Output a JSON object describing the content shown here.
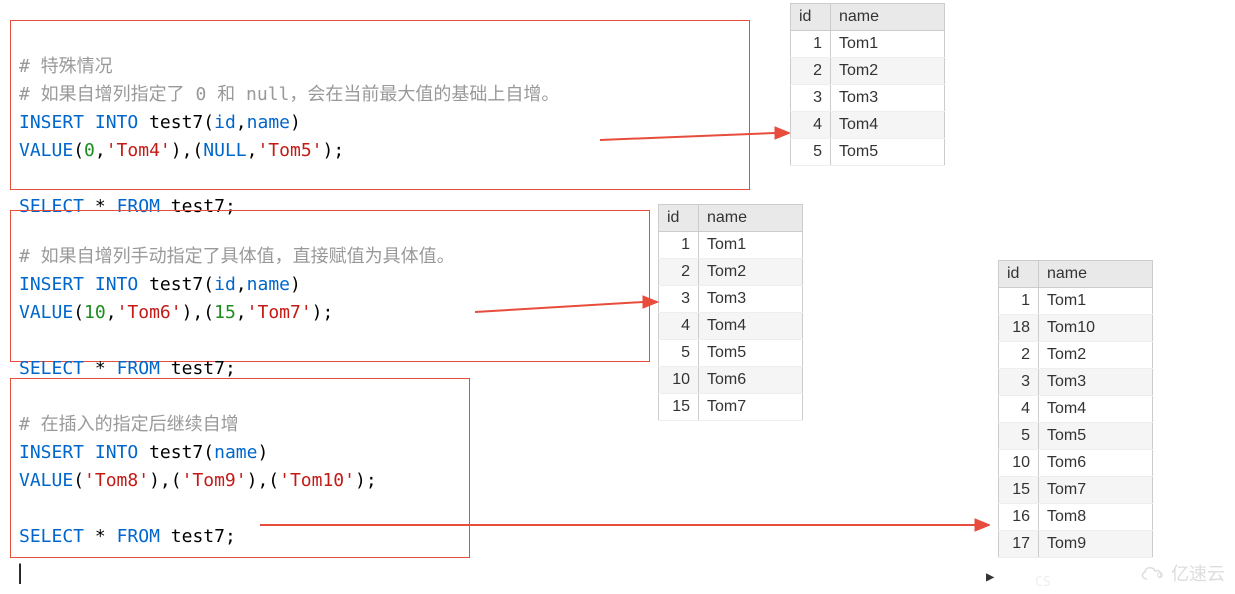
{
  "codeBlocks": {
    "block1": {
      "comment1": "# 特殊情况",
      "comment2": "# 如果自增列指定了 0 和 null，会在当前最大值的基础上自增。",
      "insert": "INSERT INTO",
      "table": "test7",
      "cols": "id,name",
      "value_kw": "VALUE",
      "values": "(0,'Tom4'),(NULL,'Tom5');",
      "select": "SELECT * FROM test7;"
    },
    "block2": {
      "comment1": "# 如果自增列手动指定了具体值，直接赋值为具体值。",
      "insert": "INSERT INTO",
      "table": "test7",
      "cols": "id,name",
      "value_kw": "VALUE",
      "values": "(10,'Tom6'),(15,'Tom7');",
      "select": "SELECT * FROM test7;"
    },
    "block3": {
      "comment1": "# 在插入的指定后继续自增",
      "insert": "INSERT INTO",
      "table": "test7",
      "cols": "name",
      "value_kw": "VALUE",
      "values": "('Tom8'),('Tom9'),('Tom10');",
      "select": "SELECT * FROM test7;"
    }
  },
  "tables": {
    "t1": {
      "headers": [
        "id",
        "name"
      ],
      "rows": [
        {
          "id": "1",
          "name": "Tom1"
        },
        {
          "id": "2",
          "name": "Tom2"
        },
        {
          "id": "3",
          "name": "Tom3"
        },
        {
          "id": "4",
          "name": "Tom4"
        },
        {
          "id": "5",
          "name": "Tom5"
        }
      ]
    },
    "t2": {
      "headers": [
        "id",
        "name"
      ],
      "rows": [
        {
          "id": "1",
          "name": "Tom1"
        },
        {
          "id": "2",
          "name": "Tom2"
        },
        {
          "id": "3",
          "name": "Tom3"
        },
        {
          "id": "4",
          "name": "Tom4"
        },
        {
          "id": "5",
          "name": "Tom5"
        },
        {
          "id": "10",
          "name": "Tom6"
        },
        {
          "id": "15",
          "name": "Tom7"
        }
      ]
    },
    "t3": {
      "headers": [
        "id",
        "name"
      ],
      "rows": [
        {
          "id": "1",
          "name": "Tom1"
        },
        {
          "id": "18",
          "name": "Tom10"
        },
        {
          "id": "2",
          "name": "Tom2"
        },
        {
          "id": "3",
          "name": "Tom3"
        },
        {
          "id": "4",
          "name": "Tom4"
        },
        {
          "id": "5",
          "name": "Tom5"
        },
        {
          "id": "10",
          "name": "Tom6"
        },
        {
          "id": "15",
          "name": "Tom7"
        },
        {
          "id": "16",
          "name": "Tom8"
        },
        {
          "id": "17",
          "name": "Tom9"
        }
      ]
    }
  },
  "chart_data": {
    "type": "table",
    "title": "MySQL auto-increment behavior examples (test7)",
    "cases": [
      {
        "label": "Insert with 0 and NULL → auto-increment from current max",
        "sql": "INSERT INTO test7(id,name) VALUE(0,'Tom4'),(NULL,'Tom5');",
        "result_columns": [
          "id",
          "name"
        ],
        "result_rows": [
          [
            1,
            "Tom1"
          ],
          [
            2,
            "Tom2"
          ],
          [
            3,
            "Tom3"
          ],
          [
            4,
            "Tom4"
          ],
          [
            5,
            "Tom5"
          ]
        ]
      },
      {
        "label": "Insert with explicit values → assigned directly",
        "sql": "INSERT INTO test7(id,name) VALUE(10,'Tom6'),(15,'Tom7');",
        "result_columns": [
          "id",
          "name"
        ],
        "result_rows": [
          [
            1,
            "Tom1"
          ],
          [
            2,
            "Tom2"
          ],
          [
            3,
            "Tom3"
          ],
          [
            4,
            "Tom4"
          ],
          [
            5,
            "Tom5"
          ],
          [
            10,
            "Tom6"
          ],
          [
            15,
            "Tom7"
          ]
        ]
      },
      {
        "label": "Continue auto-increment after explicit insert",
        "sql": "INSERT INTO test7(name) VALUE('Tom8'),('Tom9'),('Tom10');",
        "result_columns": [
          "id",
          "name"
        ],
        "result_rows": [
          [
            1,
            "Tom1"
          ],
          [
            18,
            "Tom10"
          ],
          [
            2,
            "Tom2"
          ],
          [
            3,
            "Tom3"
          ],
          [
            4,
            "Tom4"
          ],
          [
            5,
            "Tom5"
          ],
          [
            10,
            "Tom6"
          ],
          [
            15,
            "Tom7"
          ],
          [
            16,
            "Tom8"
          ],
          [
            17,
            "Tom9"
          ]
        ]
      }
    ]
  },
  "watermark": "亿速云"
}
